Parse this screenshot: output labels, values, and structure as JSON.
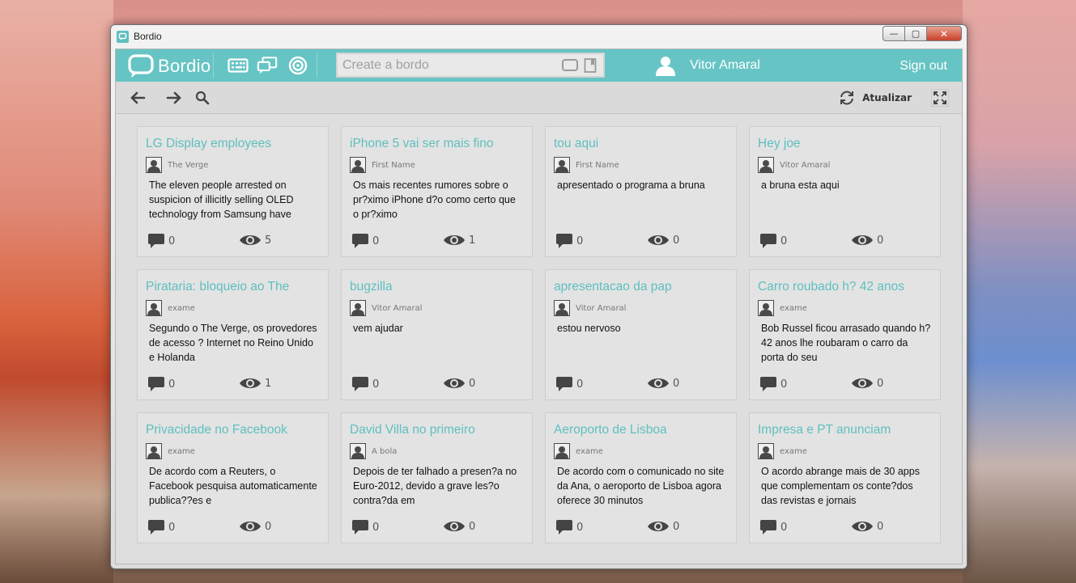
{
  "window": {
    "title": "Bordio",
    "min": "—",
    "max": "▢",
    "close": "✕"
  },
  "topbar": {
    "logo_text": "Bordio",
    "icons": [
      "keyboard-icon",
      "screens-icon",
      "target-icon"
    ],
    "search_placeholder": "Create a bordo",
    "user_name": "Vitor Amaral",
    "sign_out": "Sign out"
  },
  "navbar": {
    "refresh_label": "Atualizar"
  },
  "colors": {
    "accent": "#67c4c4",
    "title": "#5fbfbf"
  },
  "cards": [
    {
      "title": "LG Display employees",
      "author": "The  Verge",
      "body": "The eleven people arrested on suspicion of illicitly selling OLED technology from Samsung have",
      "comments": "0",
      "views": "5"
    },
    {
      "title": "iPhone 5 vai ser mais fino",
      "author": "First Name",
      "body": "Os mais recentes rumores sobre o pr?ximo iPhone d?o como certo que o pr?ximo",
      "comments": "0",
      "views": "1"
    },
    {
      "title": "tou aqui",
      "author": "First Name",
      "body": "apresentado o programa a bruna",
      "comments": "0",
      "views": "0"
    },
    {
      "title": "Hey joe",
      "author": "Vitor Amaral",
      "body": "a bruna esta aqui",
      "comments": "0",
      "views": "0"
    },
    {
      "title": "Pirataria: bloqueio ao The",
      "author": "exame",
      "body": "Segundo o The Verge, os provedores de acesso ? Internet no Reino Unido e Holanda",
      "comments": "0",
      "views": "1"
    },
    {
      "title": "bugzilla",
      "author": "Vitor Amaral",
      "body": "vem ajudar",
      "comments": "0",
      "views": "0"
    },
    {
      "title": "apresentacao da pap",
      "author": "Vitor Amaral",
      "body": "estou nervoso",
      "comments": "0",
      "views": "0"
    },
    {
      "title": "Carro roubado h? 42 anos",
      "author": "exame",
      "body": "Bob Russel ficou arrasado quando h? 42 anos lhe roubaram o carro da porta do seu",
      "comments": "0",
      "views": "0"
    },
    {
      "title": "Privacidade no Facebook",
      "author": "exame",
      "body": "De acordo com a Reuters, o Facebook pesquisa automaticamente publica??es e",
      "comments": "0",
      "views": "0"
    },
    {
      "title": "David Villa no primeiro",
      "author": "A bola",
      "body": "Depois de ter falhado a presen?a no Euro-2012, devido a grave les?o contra?da em",
      "comments": "0",
      "views": "0"
    },
    {
      "title": "Aeroporto de Lisboa",
      "author": "exame",
      "body": "De acordo com o comunicado no site da Ana, o aeroporto de Lisboa agora oferece 30 minutos",
      "comments": "0",
      "views": "0"
    },
    {
      "title": "Impresa e PT anunciam",
      "author": "exame",
      "body": "O acordo abrange mais de 30 apps que complementam os conte?dos das revistas e jornais",
      "comments": "0",
      "views": "0"
    }
  ]
}
